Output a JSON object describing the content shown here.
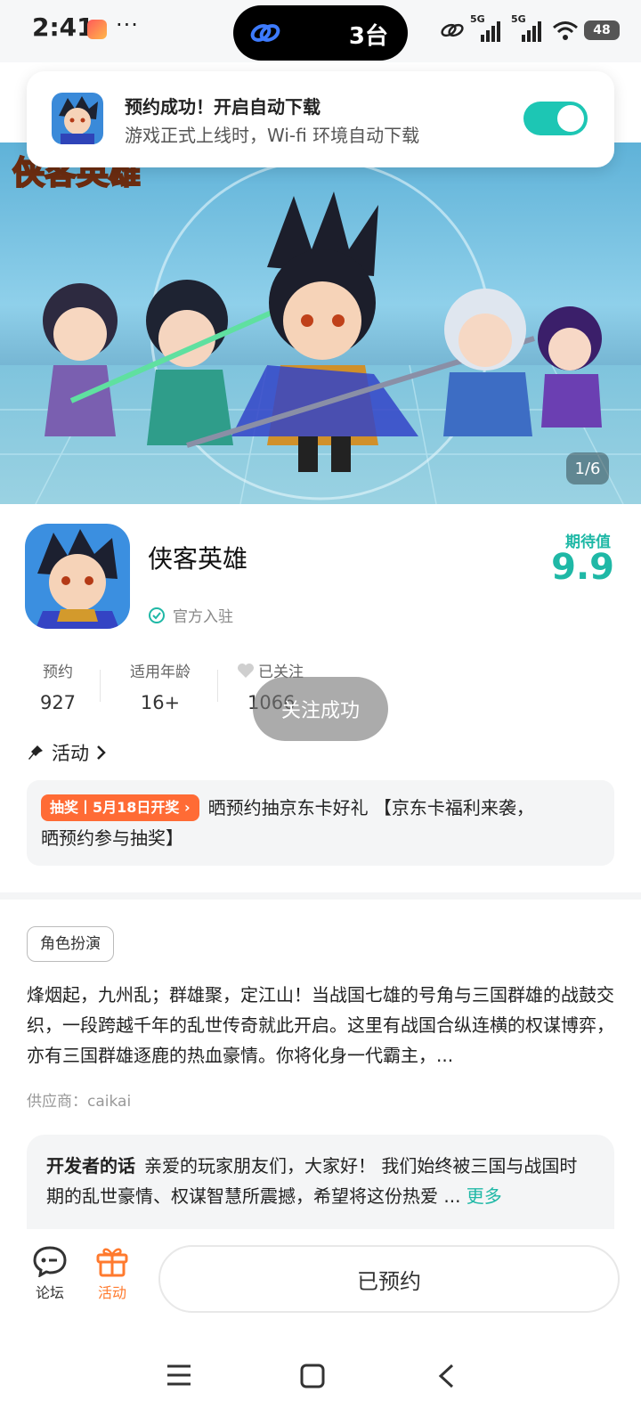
{
  "status_bar": {
    "time": "2:41",
    "dots": "···",
    "island_text": "3台",
    "signal_1": "5G",
    "signal_2": "5G",
    "battery": "48"
  },
  "notification": {
    "title": "预约成功！开启自动下载",
    "subtitle": "游戏正式上线时，Wi-fi 环境自动下载",
    "toggle_on": true
  },
  "hero": {
    "logo_text": "侠客英雄",
    "counter": "1/6"
  },
  "app": {
    "name": "侠客英雄",
    "official_label": "官方入驻",
    "expect_label": "期待值",
    "expect_value": "9.9"
  },
  "stats": [
    {
      "label": "预约",
      "value": "927"
    },
    {
      "label": "适用年龄",
      "value": "16+"
    },
    {
      "label": "已关注",
      "value": "1066"
    }
  ],
  "follow_toast": "关注成功",
  "activity": {
    "heading": "活动",
    "badge": "抽奖丨5月18日开奖",
    "text_line1": "晒预约抽京东卡好礼 【京东卡福利来袭，",
    "text_line2": "晒预约参与抽奖】"
  },
  "genre_tag": "角色扮演",
  "description": "烽烟起，九州乱；群雄聚，定江山！当战国七雄的号角与三国群雄的战鼓交织，一段跨越千年的乱世传奇就此开启。这里有战国合纵连横的权谋博弈，亦有三国群雄逐鹿的热血豪情。你将化身一代霸主，...",
  "supplier": "供应商：caikai",
  "developer": {
    "title": "开发者的话",
    "text": "亲爱的玩家朋友们，大家好！ 我们始终被三国与战国时期的乱世豪情、权谋智慧所震撼，希望将这份热爱 ...",
    "more": "更多"
  },
  "bottom_bar": {
    "forum_label": "论坛",
    "activity_label": "活动",
    "reserved_button": "已预约"
  },
  "colors": {
    "accent": "#1fb8a6",
    "toggle": "#1dc6b4",
    "badge": "#ff6b35",
    "activity_tab": "#ff7a2e"
  }
}
